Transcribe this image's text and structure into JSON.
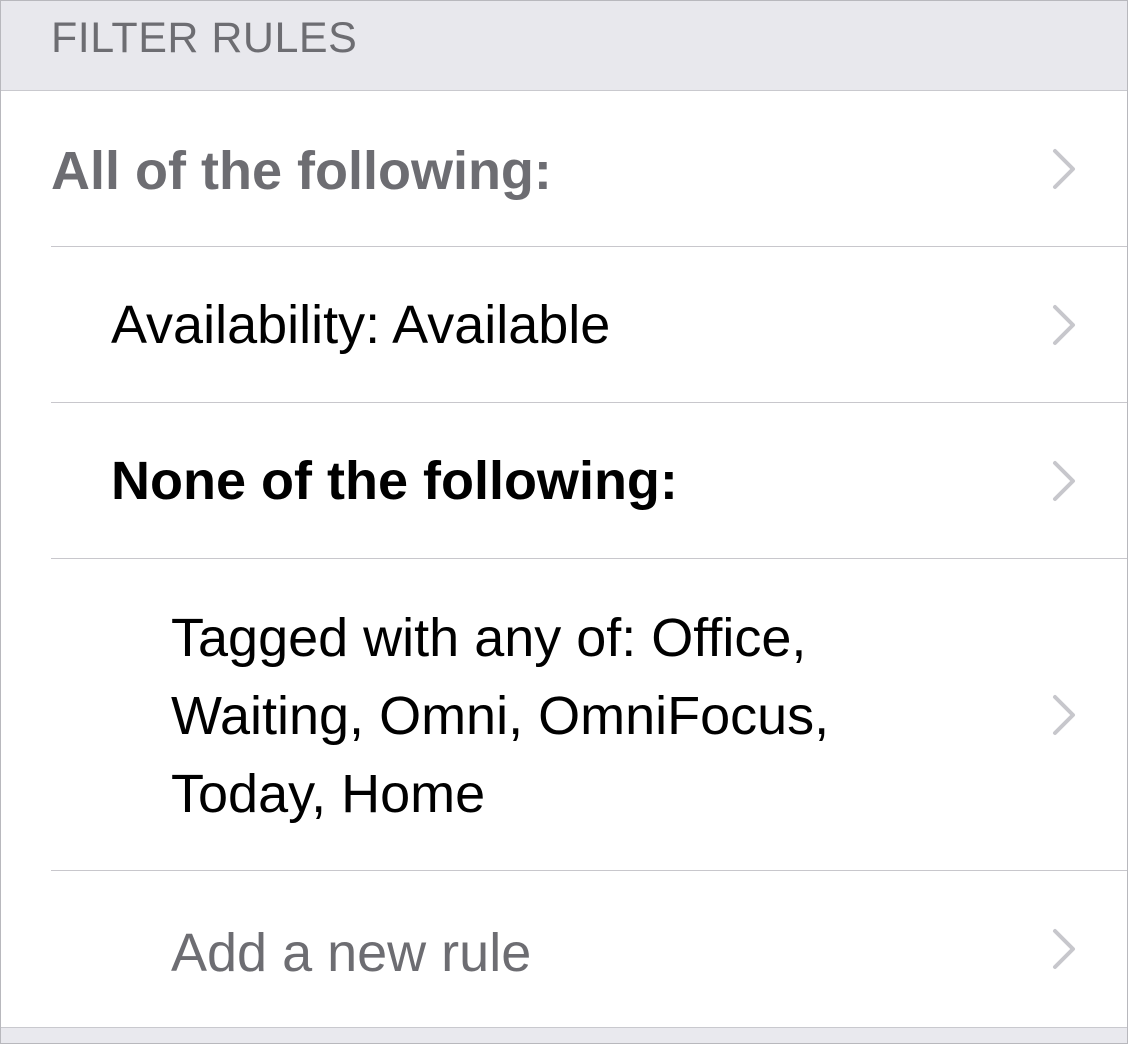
{
  "section": {
    "header": "FILTER RULES"
  },
  "rules": [
    {
      "label": "All of the following:",
      "style": "group-bold-gray",
      "indent": 0
    },
    {
      "label": "Availability: Available",
      "style": "normal",
      "indent": 1
    },
    {
      "label": "None of the following:",
      "style": "group-bold-black",
      "indent": 1
    },
    {
      "label": "Tagged with any of: Office, Waiting, Omni, OmniFocus, Today, Home",
      "style": "normal",
      "indent": 2
    },
    {
      "label": "Add a new rule",
      "style": "placeholder-gray",
      "indent": 2
    }
  ],
  "icons": {
    "disclosure": "chevron-right-icon"
  },
  "colors": {
    "header_bg": "#e8e8ed",
    "secondary_text": "#6d6d72",
    "primary_text": "#000000",
    "chevron": "#c7c7cc",
    "separator": "#c8c7cc"
  }
}
